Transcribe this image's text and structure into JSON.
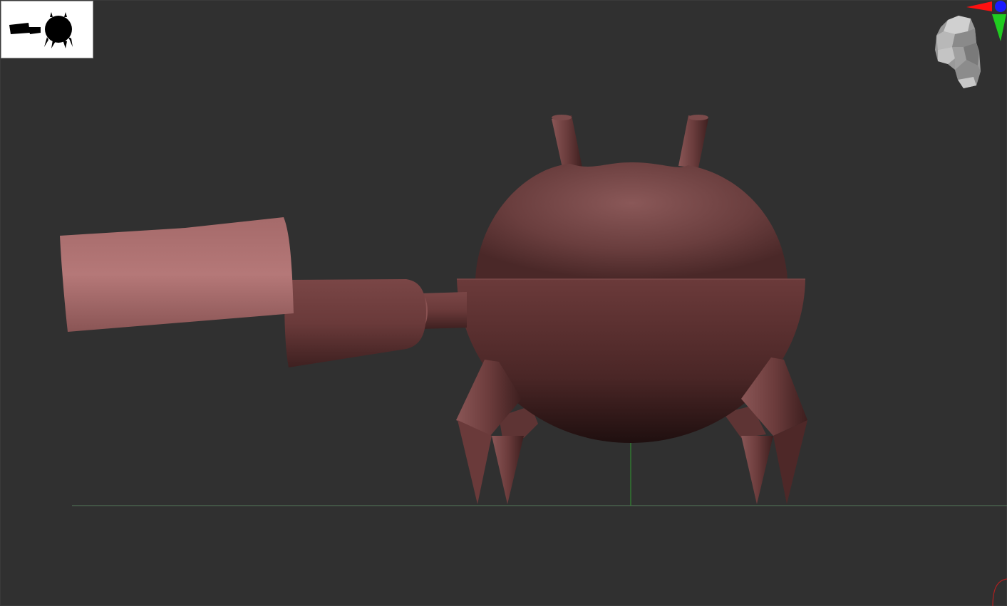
{
  "app": {
    "view": "3D viewport"
  },
  "colors": {
    "background": "#303030",
    "model_base": "#6b3c3c",
    "model_highlight": "#a87070",
    "ground_line": "#5a8a5a",
    "axis_vertical": "#2f9a2f",
    "axis_x": "#ff1a1a",
    "axis_y": "#22cc22",
    "axis_z": "#1a1aff",
    "thumbnail_bg": "#ffffff"
  },
  "icons": {
    "thumbnail": "model-silhouette-icon",
    "navigator": "head-navigator-icon",
    "axis_gizmo": "axis-gizmo-icon",
    "corner": "rotation-gizmo-icon"
  }
}
